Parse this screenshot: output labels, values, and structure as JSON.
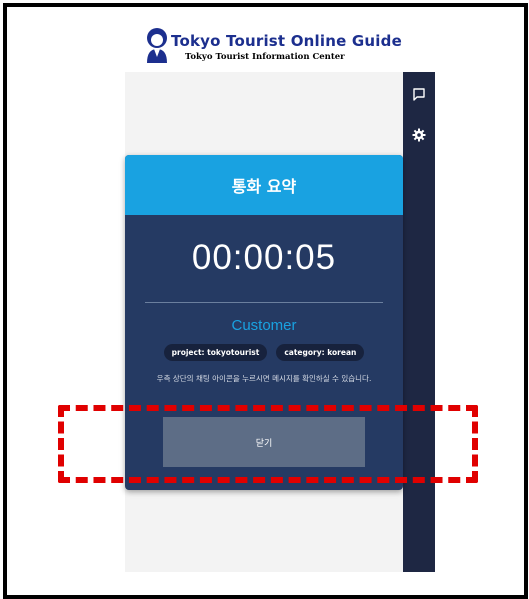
{
  "header": {
    "brand_title": "Tokyo Tourist Online Guide",
    "brand_subtitle": "Tokyo Tourist Information Center",
    "brand_icon": "guide-woman-icon"
  },
  "sidebar": {
    "items": [
      {
        "icon": "chat-icon"
      },
      {
        "icon": "gear-icon"
      }
    ]
  },
  "modal": {
    "title": "통화 요약",
    "timer": "00:00:05",
    "caller": "Customer",
    "tags": [
      "project: tokyotourist",
      "category: korean"
    ],
    "info": "우측 상단의 채팅 아이콘을 누르시면 메시지를 확인하실 수 있습니다.",
    "close_label": "닫기"
  },
  "colors": {
    "header_blue": "#19a2e1",
    "modal_bg": "#253a63",
    "sidebar_bg": "#1e2743",
    "highlight_red": "#e00000",
    "button_bg": "#5d6d86"
  }
}
